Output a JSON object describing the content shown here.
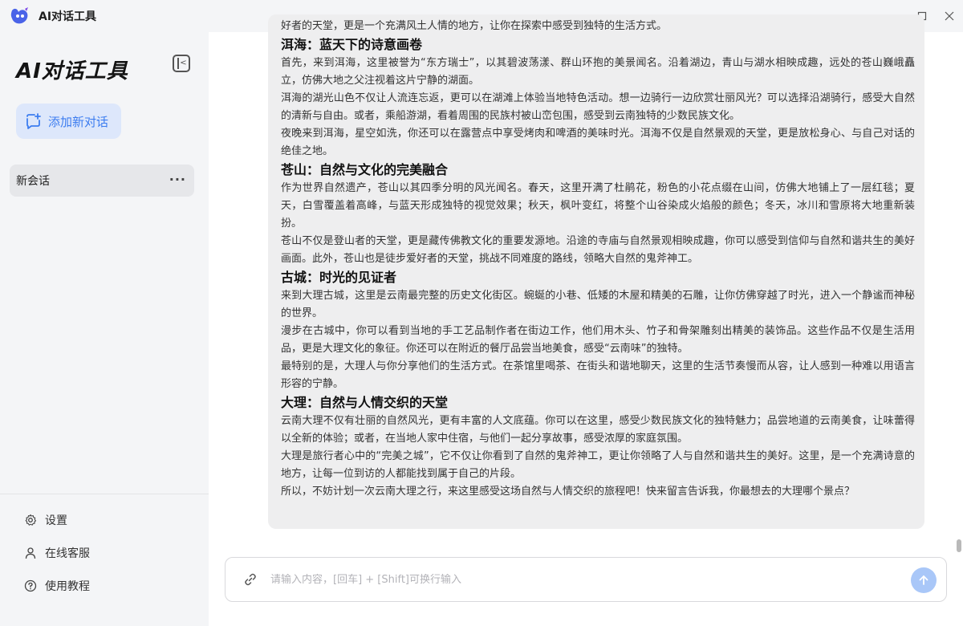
{
  "titlebar": {
    "app_title": "AI对话工具",
    "minimize_glyph": "—",
    "maximize_glyph": "☐",
    "close_glyph": "✕"
  },
  "sidebar": {
    "brand": "AI对话工具",
    "new_chat_label": "添加新对话",
    "sessions": [
      {
        "label": "新会话",
        "more": "···"
      }
    ],
    "bottom_items": [
      {
        "label": "设置",
        "icon": "gear-icon"
      },
      {
        "label": "在线客服",
        "icon": "user-icon"
      },
      {
        "label": "使用教程",
        "icon": "help-icon"
      }
    ]
  },
  "message": {
    "blocks": [
      {
        "type": "p",
        "text": "好者的天堂，更是一个充满风土人情的地方，让你在探索中感受到独特的生活方式。"
      },
      {
        "type": "h",
        "text": "洱海：蓝天下的诗意画卷"
      },
      {
        "type": "p",
        "text": "首先，来到洱海，这里被誉为“东方瑞士”，以其碧波荡漾、群山环抱的美景闻名。沿着湖边，青山与湖水相映成趣，远处的苍山巍峨矗立，仿佛大地之父注视着这片宁静的湖面。"
      },
      {
        "type": "p",
        "text": "洱海的湖光山色不仅让人流连忘返，更可以在湖滩上体验当地特色活动。想一边骑行一边欣赏壮丽风光？可以选择沿湖骑行，感受大自然的清新与自由。或者，乘船游湖，看着周围的民族村被山峦包围，感受到云南独特的少数民族文化。"
      },
      {
        "type": "p",
        "text": "夜晚来到洱海，星空如洗，你还可以在露营点中享受烤肉和啤酒的美味时光。洱海不仅是自然景观的天堂，更是放松身心、与自己对话的绝佳之地。"
      },
      {
        "type": "h",
        "text": "苍山：自然与文化的完美融合"
      },
      {
        "type": "p",
        "text": "作为世界自然遗产，苍山以其四季分明的风光闻名。春天，这里开满了杜鹃花，粉色的小花点缀在山间，仿佛大地铺上了一层红毯；夏天，白雪覆盖着高峰，与蓝天形成独特的视觉效果；秋天，枫叶变红，将整个山谷染成火焰般的颜色；冬天，冰川和雪原将大地重新装扮。"
      },
      {
        "type": "p",
        "text": "苍山不仅是登山者的天堂，更是藏传佛教文化的重要发源地。沿途的寺庙与自然景观相映成趣，你可以感受到信仰与自然和谐共生的美好画面。此外，苍山也是徒步爱好者的天堂，挑战不同难度的路线，领略大自然的鬼斧神工。"
      },
      {
        "type": "h",
        "text": "古城：时光的见证者"
      },
      {
        "type": "p",
        "text": "来到大理古城，这里是云南最完整的历史文化街区。蜿蜒的小巷、低矮的木屋和精美的石雕，让你仿佛穿越了时光，进入一个静谧而神秘的世界。"
      },
      {
        "type": "p",
        "text": "漫步在古城中，你可以看到当地的手工艺品制作者在街边工作，他们用木头、竹子和骨架雕刻出精美的装饰品。这些作品不仅是生活用品，更是大理文化的象征。你还可以在附近的餐厅品尝当地美食，感受“云南味”的独特。"
      },
      {
        "type": "p",
        "text": "最特别的是，大理人与你分享他们的生活方式。在茶馆里喝茶、在街头和谐地聊天，这里的生活节奏慢而从容，让人感到一种难以用语言形容的宁静。"
      },
      {
        "type": "h",
        "text": "大理：自然与人情交织的天堂"
      },
      {
        "type": "p",
        "text": "云南大理不仅有壮丽的自然风光，更有丰富的人文底蕴。你可以在这里，感受少数民族文化的独特魅力；品尝地道的云南美食，让味蕾得以全新的体验；或者，在当地人家中住宿，与他们一起分享故事，感受浓厚的家庭氛围。"
      },
      {
        "type": "p",
        "text": "大理是旅行者心中的“完美之城”，它不仅让你看到了自然的鬼斧神工，更让你领略了人与自然和谐共生的美好。这里，是一个充满诗意的地方，让每一位到访的人都能找到属于自己的片段。"
      },
      {
        "type": "p",
        "text": "所以，不妨计划一次云南大理之行，来这里感受这场自然与人情交织的旅程吧！快来留言告诉我，你最想去的大理哪个景点？"
      }
    ]
  },
  "composer": {
    "placeholder": "请输入内容，[回车] + [Shift]可换行输入",
    "value": ""
  },
  "colors": {
    "accent": "#3d7df0",
    "send_button": "#a9c7f8",
    "sidebar_bg": "#f4f5f7",
    "bubble_bg": "#eeeeef"
  }
}
